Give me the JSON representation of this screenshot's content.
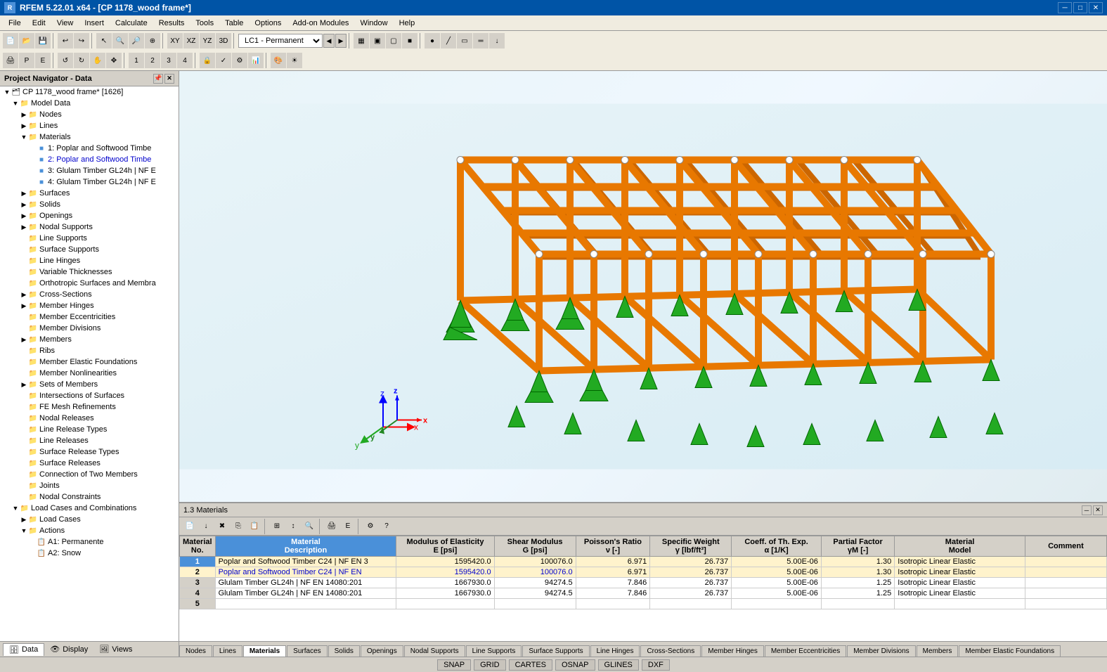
{
  "titlebar": {
    "title": "RFEM 5.22.01 x64 - [CP 1178_wood frame*]",
    "icon": "R"
  },
  "menubar": {
    "items": [
      "File",
      "Edit",
      "View",
      "Insert",
      "Calculate",
      "Results",
      "Tools",
      "Table",
      "Options",
      "Add-on Modules",
      "Window",
      "Help"
    ]
  },
  "toolbar": {
    "lc_dropdown": "LC1 - Permanent"
  },
  "left_panel": {
    "title": "Project Navigator - Data",
    "tree": {
      "root": "CP 1178_wood frame* [1626]",
      "items": [
        {
          "label": "Model Data",
          "level": 1,
          "type": "folder",
          "expanded": true
        },
        {
          "label": "Nodes",
          "level": 2,
          "type": "folder"
        },
        {
          "label": "Lines",
          "level": 2,
          "type": "folder"
        },
        {
          "label": "Materials",
          "level": 2,
          "type": "folder",
          "expanded": true
        },
        {
          "label": "1: Poplar and Softwood Timbe",
          "level": 3,
          "type": "material",
          "icon": "M"
        },
        {
          "label": "2: Poplar and Softwood Timbe",
          "level": 3,
          "type": "material",
          "icon": "M",
          "blue": true
        },
        {
          "label": "3: Glulam Timber GL24h | NF E",
          "level": 3,
          "type": "material",
          "icon": "M"
        },
        {
          "label": "4: Glulam Timber GL24h | NF E",
          "level": 3,
          "type": "material",
          "icon": "M"
        },
        {
          "label": "Surfaces",
          "level": 2,
          "type": "folder"
        },
        {
          "label": "Solids",
          "level": 2,
          "type": "folder"
        },
        {
          "label": "Openings",
          "level": 2,
          "type": "folder"
        },
        {
          "label": "Nodal Supports",
          "level": 2,
          "type": "folder"
        },
        {
          "label": "Line Supports",
          "level": 2,
          "type": "folder"
        },
        {
          "label": "Surface Supports",
          "level": 2,
          "type": "folder"
        },
        {
          "label": "Line Hinges",
          "level": 2,
          "type": "folder"
        },
        {
          "label": "Variable Thicknesses",
          "level": 2,
          "type": "folder"
        },
        {
          "label": "Orthotropic Surfaces and Membra",
          "level": 2,
          "type": "folder"
        },
        {
          "label": "Cross-Sections",
          "level": 2,
          "type": "folder"
        },
        {
          "label": "Member Hinges",
          "level": 2,
          "type": "folder"
        },
        {
          "label": "Member Eccentricities",
          "level": 2,
          "type": "folder"
        },
        {
          "label": "Member Divisions",
          "level": 2,
          "type": "folder"
        },
        {
          "label": "Members",
          "level": 2,
          "type": "folder"
        },
        {
          "label": "Ribs",
          "level": 2,
          "type": "folder"
        },
        {
          "label": "Member Elastic Foundations",
          "level": 2,
          "type": "folder"
        },
        {
          "label": "Member Nonlinearities",
          "level": 2,
          "type": "folder"
        },
        {
          "label": "Sets of Members",
          "level": 2,
          "type": "folder"
        },
        {
          "label": "Intersections of Surfaces",
          "level": 2,
          "type": "folder"
        },
        {
          "label": "FE Mesh Refinements",
          "level": 2,
          "type": "folder"
        },
        {
          "label": "Nodal Releases",
          "level": 2,
          "type": "folder"
        },
        {
          "label": "Line Release Types",
          "level": 2,
          "type": "folder"
        },
        {
          "label": "Line Releases",
          "level": 2,
          "type": "folder"
        },
        {
          "label": "Surface Release Types",
          "level": 2,
          "type": "folder"
        },
        {
          "label": "Surface Releases",
          "level": 2,
          "type": "folder"
        },
        {
          "label": "Connection of Two Members",
          "level": 2,
          "type": "folder"
        },
        {
          "label": "Joints",
          "level": 2,
          "type": "folder"
        },
        {
          "label": "Nodal Constraints",
          "level": 2,
          "type": "folder"
        },
        {
          "label": "Load Cases and Combinations",
          "level": 1,
          "type": "folder",
          "expanded": true
        },
        {
          "label": "Load Cases",
          "level": 2,
          "type": "folder"
        },
        {
          "label": "Actions",
          "level": 2,
          "type": "folder",
          "expanded": true
        },
        {
          "label": "A1: Permanente",
          "level": 3,
          "type": "action"
        },
        {
          "label": "A2: Snow",
          "level": 3,
          "type": "action"
        }
      ]
    }
  },
  "bottom_panel": {
    "title": "1.3 Materials",
    "columns": [
      {
        "id": "A",
        "header": "Material\nNo.",
        "sub": ""
      },
      {
        "id": "B",
        "header": "Material\nDescription",
        "sub": ""
      },
      {
        "id": "C",
        "header": "Modulus of Elasticity\nE [psi]",
        "sub": ""
      },
      {
        "id": "D",
        "header": "Shear Modulus\nG [psi]",
        "sub": ""
      },
      {
        "id": "E",
        "header": "Poisson's Ratio\nν [-]",
        "sub": ""
      },
      {
        "id": "F",
        "header": "Specific Weight\nγ [lbf/ft³]",
        "sub": ""
      },
      {
        "id": "G",
        "header": "Coeff. of Th. Exp.\nα [1/K]",
        "sub": ""
      },
      {
        "id": "H",
        "header": "Partial Factor\nγM [-]",
        "sub": ""
      },
      {
        "id": "I",
        "header": "Material\nModel",
        "sub": ""
      },
      {
        "id": "J",
        "header": "Comment",
        "sub": ""
      }
    ],
    "rows": [
      {
        "no": "1",
        "desc": "Poplar and Softwood Timber C24 | NF EN 3",
        "e": "1595420.0",
        "g": "100076.0",
        "nu": "6.971",
        "gamma": "26.737",
        "alpha": "5.00E-06",
        "pf": "1.30",
        "model": "Isotropic Linear Elastic",
        "comment": "",
        "highlighted": true
      },
      {
        "no": "2",
        "desc": "Poplar and Softwood Timber C24 | NF EN",
        "e": "1595420.0",
        "g": "100076.0",
        "nu": "6.971",
        "gamma": "26.737",
        "alpha": "5.00E-06",
        "pf": "1.30",
        "model": "Isotropic Linear Elastic",
        "comment": "",
        "highlighted": true,
        "blue": true
      },
      {
        "no": "3",
        "desc": "Glulam Timber GL24h | NF EN 14080:201",
        "e": "1667930.0",
        "g": "94274.5",
        "nu": "7.846",
        "gamma": "26.737",
        "alpha": "5.00E-06",
        "pf": "1.25",
        "model": "Isotropic Linear Elastic",
        "comment": ""
      },
      {
        "no": "4",
        "desc": "Glulam Timber GL24h | NF EN 14080:201",
        "e": "1667930.0",
        "g": "94274.5",
        "nu": "7.846",
        "gamma": "26.737",
        "alpha": "5.00E-06",
        "pf": "1.25",
        "model": "Isotropic Linear Elastic",
        "comment": ""
      },
      {
        "no": "5",
        "desc": "",
        "e": "",
        "g": "",
        "nu": "",
        "gamma": "",
        "alpha": "",
        "pf": "",
        "model": "",
        "comment": ""
      }
    ]
  },
  "tabs": {
    "items": [
      "Nodes",
      "Lines",
      "Materials",
      "Surfaces",
      "Solids",
      "Openings",
      "Nodal Supports",
      "Line Supports",
      "Surface Supports",
      "Line Hinges",
      "Cross-Sections",
      "Member Hinges",
      "Member Eccentricities",
      "Member Divisions",
      "Members",
      "Member Elastic Foundations"
    ],
    "active": "Materials"
  },
  "status_bar": {
    "items": [
      "SNAP",
      "GRID",
      "CARTES",
      "OSNAP",
      "GLINES",
      "DXF"
    ]
  },
  "nav_tabs": {
    "items": [
      "Data",
      "Display",
      "Views"
    ],
    "active": "Data"
  }
}
